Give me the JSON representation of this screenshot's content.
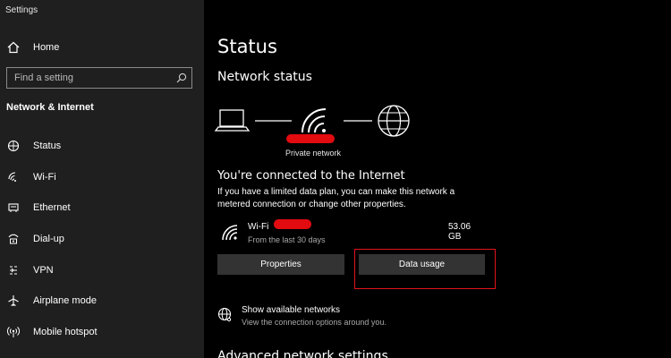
{
  "window": {
    "title": "Settings"
  },
  "sidebar": {
    "home_label": "Home",
    "search_placeholder": "Find a setting",
    "section_title": "Network & Internet",
    "items": [
      {
        "label": "Status",
        "icon": "status-icon"
      },
      {
        "label": "Wi-Fi",
        "icon": "wifi-icon"
      },
      {
        "label": "Ethernet",
        "icon": "ethernet-icon"
      },
      {
        "label": "Dial-up",
        "icon": "dialup-icon"
      },
      {
        "label": "VPN",
        "icon": "vpn-icon"
      },
      {
        "label": "Airplane mode",
        "icon": "airplane-icon"
      },
      {
        "label": "Mobile hotspot",
        "icon": "hotspot-icon"
      }
    ]
  },
  "main": {
    "title": "Status",
    "network_status_heading": "Network status",
    "network_caption": "Private network",
    "connected_heading": "You're connected to the Internet",
    "info_text": "If you have a limited data plan, you can make this network a metered connection or change other properties.",
    "wifi": {
      "name": "Wi-Fi",
      "subtitle": "From the last 30 days",
      "usage": "53.06 GB"
    },
    "buttons": {
      "properties": "Properties",
      "data_usage": "Data usage"
    },
    "available_networks": {
      "title": "Show available networks",
      "subtitle": "View the connection options around you."
    },
    "advanced_heading": "Advanced network settings"
  },
  "colors": {
    "sidebar_bg": "#1f1f1f",
    "main_bg": "#000000",
    "button_bg": "#333333",
    "highlight": "#e0141c"
  }
}
